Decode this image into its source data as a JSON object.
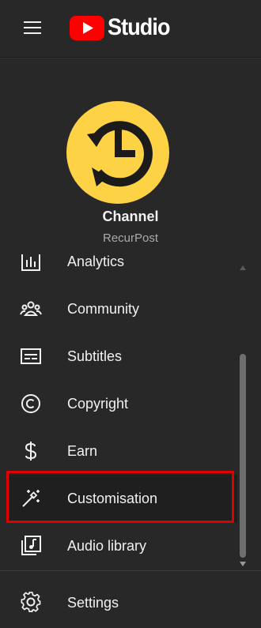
{
  "app": {
    "logo_text": "Studio",
    "brand_color": "#ff0000"
  },
  "channel": {
    "title": "Channel",
    "name": "RecurPost",
    "avatar_color": "#fdd245"
  },
  "nav": {
    "items": [
      {
        "label": "Analytics",
        "icon": "analytics-icon"
      },
      {
        "label": "Community",
        "icon": "community-icon"
      },
      {
        "label": "Subtitles",
        "icon": "subtitles-icon"
      },
      {
        "label": "Copyright",
        "icon": "copyright-icon"
      },
      {
        "label": "Earn",
        "icon": "earn-icon"
      },
      {
        "label": "Customisation",
        "icon": "magic-wand-icon",
        "active": true
      },
      {
        "label": "Audio library",
        "icon": "audio-library-icon"
      }
    ]
  },
  "footer": {
    "settings_label": "Settings"
  },
  "colors": {
    "background": "#282828",
    "highlight_border": "#e00000",
    "text": "#f1f1f1",
    "secondary_text": "#aaaaaa"
  }
}
